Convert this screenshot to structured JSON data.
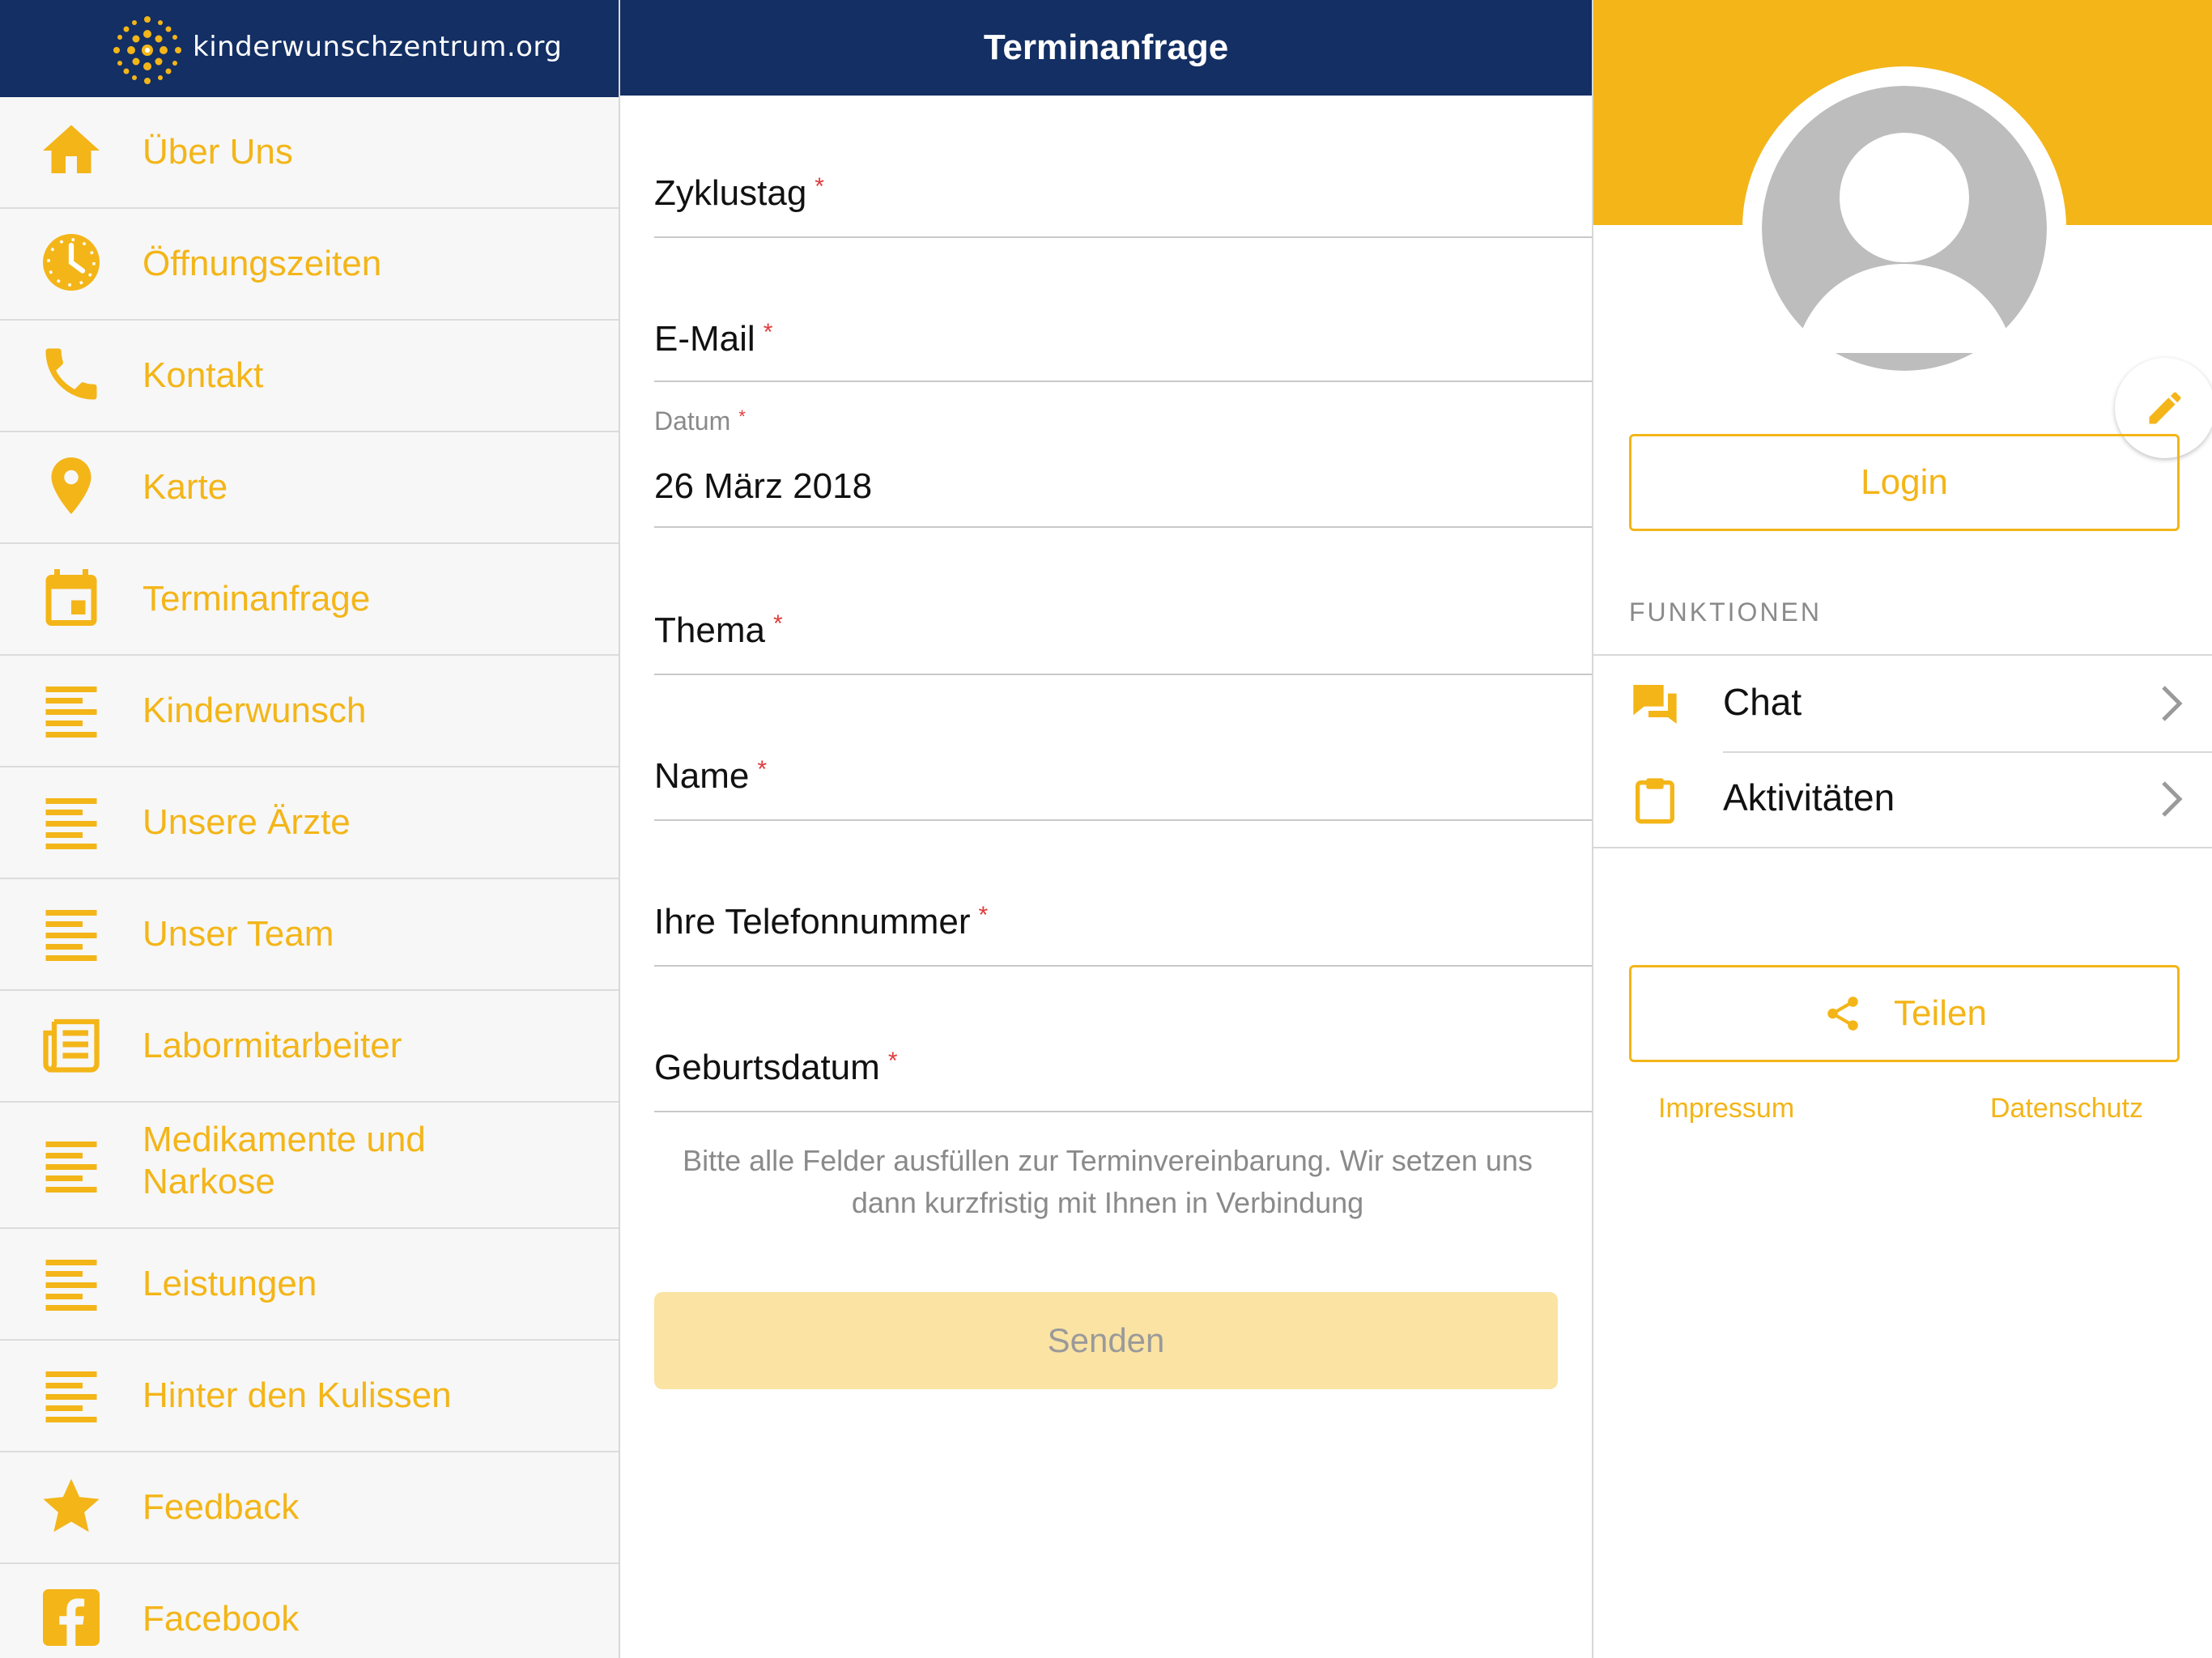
{
  "colors": {
    "navy": "#132f64",
    "accent": "#f3b518",
    "required": "#e23a3a"
  },
  "sidebar": {
    "logo_text": "kinderwunschzentrum.org",
    "items": [
      {
        "label": "Über Uns",
        "icon": "home-icon"
      },
      {
        "label": "Öffnungszeiten",
        "icon": "clock-icon"
      },
      {
        "label": "Kontakt",
        "icon": "phone-icon"
      },
      {
        "label": "Karte",
        "icon": "map-pin-icon"
      },
      {
        "label": "Terminanfrage",
        "icon": "calendar-icon"
      },
      {
        "label": "Kinderwunsch",
        "icon": "text-lines-icon"
      },
      {
        "label": "Unsere Ärzte",
        "icon": "text-lines-icon"
      },
      {
        "label": "Unser Team",
        "icon": "text-lines-icon"
      },
      {
        "label": "Labormitarbeiter",
        "icon": "newspaper-icon"
      },
      {
        "label": "Medikamente und Narkose",
        "icon": "text-lines-icon"
      },
      {
        "label": "Leistungen",
        "icon": "text-lines-icon"
      },
      {
        "label": "Hinter den Kulissen",
        "icon": "text-lines-icon"
      },
      {
        "label": "Feedback",
        "icon": "star-icon"
      },
      {
        "label": "Facebook",
        "icon": "facebook-icon"
      }
    ]
  },
  "form": {
    "title": "Terminanfrage",
    "fields": [
      {
        "label": "Zyklustag",
        "required": true
      },
      {
        "label": "E-Mail",
        "required": true
      },
      {
        "label": "Datum",
        "required": true,
        "value": "26 März 2018"
      },
      {
        "label": "Thema",
        "required": true
      },
      {
        "label": "Name",
        "required": true
      },
      {
        "label": "Ihre Telefonnummer",
        "required": true
      },
      {
        "label": "Geburtsdatum",
        "required": true
      }
    ],
    "required_mark": "*",
    "hint": "Bitte alle Felder ausfüllen zur Terminvereinbarung. Wir setzen uns dann kurzfristig mit Ihnen in Verbindung",
    "submit_label": "Senden"
  },
  "profile": {
    "login_label": "Login",
    "section_title": "FUNKTIONEN",
    "functions": [
      {
        "label": "Chat",
        "icon": "chat-icon"
      },
      {
        "label": "Aktivitäten",
        "icon": "clipboard-icon"
      }
    ],
    "share_label": "Teilen",
    "links": {
      "impressum": "Impressum",
      "datenschutz": "Datenschutz"
    }
  }
}
